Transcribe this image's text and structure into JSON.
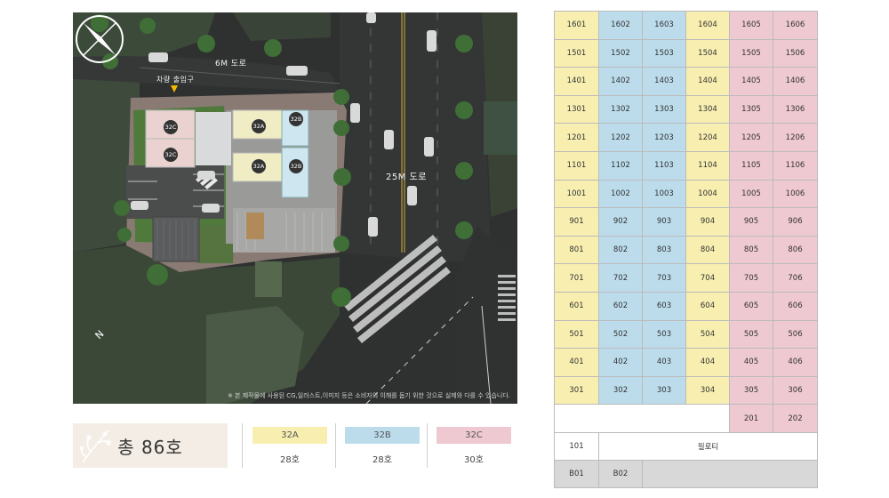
{
  "map": {
    "road_6m": "6M 도로",
    "road_25m": "25M 도로",
    "entrance": "차량 출입구",
    "compass_north": "N",
    "note": "※ 본 제작물에 사용된 CG,일러스트,이미지 등은 소비자의 이해를 돕기 위한 것으로 실제와 다를 수 있습니다.",
    "units": [
      "32C",
      "32C",
      "32A",
      "32A",
      "32B",
      "32B"
    ]
  },
  "legend": {
    "total": "총 86호",
    "types": [
      {
        "name": "32A",
        "count": "28호",
        "color": "#f7eeb0"
      },
      {
        "name": "32B",
        "count": "28호",
        "color": "#bcdcec"
      },
      {
        "name": "32C",
        "count": "30호",
        "color": "#eec9d1"
      }
    ]
  },
  "table": {
    "floors": [
      [
        "1601",
        "1602",
        "1603",
        "1604",
        "1605",
        "1606"
      ],
      [
        "1501",
        "1502",
        "1503",
        "1504",
        "1505",
        "1506"
      ],
      [
        "1401",
        "1402",
        "1403",
        "1404",
        "1405",
        "1406"
      ],
      [
        "1301",
        "1302",
        "1303",
        "1304",
        "1305",
        "1306"
      ],
      [
        "1201",
        "1202",
        "1203",
        "1204",
        "1205",
        "1206"
      ],
      [
        "1101",
        "1102",
        "1103",
        "1104",
        "1105",
        "1106"
      ],
      [
        "1001",
        "1002",
        "1003",
        "1004",
        "1005",
        "1006"
      ],
      [
        "901",
        "902",
        "903",
        "904",
        "905",
        "906"
      ],
      [
        "801",
        "802",
        "803",
        "804",
        "805",
        "806"
      ],
      [
        "701",
        "702",
        "703",
        "704",
        "705",
        "706"
      ],
      [
        "601",
        "602",
        "603",
        "604",
        "605",
        "606"
      ],
      [
        "501",
        "502",
        "503",
        "504",
        "505",
        "506"
      ],
      [
        "401",
        "402",
        "403",
        "404",
        "405",
        "406"
      ],
      [
        "301",
        "302",
        "303",
        "304",
        "305",
        "306"
      ]
    ],
    "floor2": [
      "201",
      "202"
    ],
    "floor1": {
      "unit": "101",
      "pilotis": "필로티"
    },
    "basement": [
      "B01",
      "B02"
    ],
    "column_types": [
      "32A",
      "32B",
      "32B",
      "32A",
      "32C",
      "32C"
    ],
    "colors": {
      "32A": "#f7eeb0",
      "32B": "#bcdcec",
      "32C": "#eec9d1",
      "blank": "#ffffff",
      "basement": "#d8d8d8"
    }
  }
}
